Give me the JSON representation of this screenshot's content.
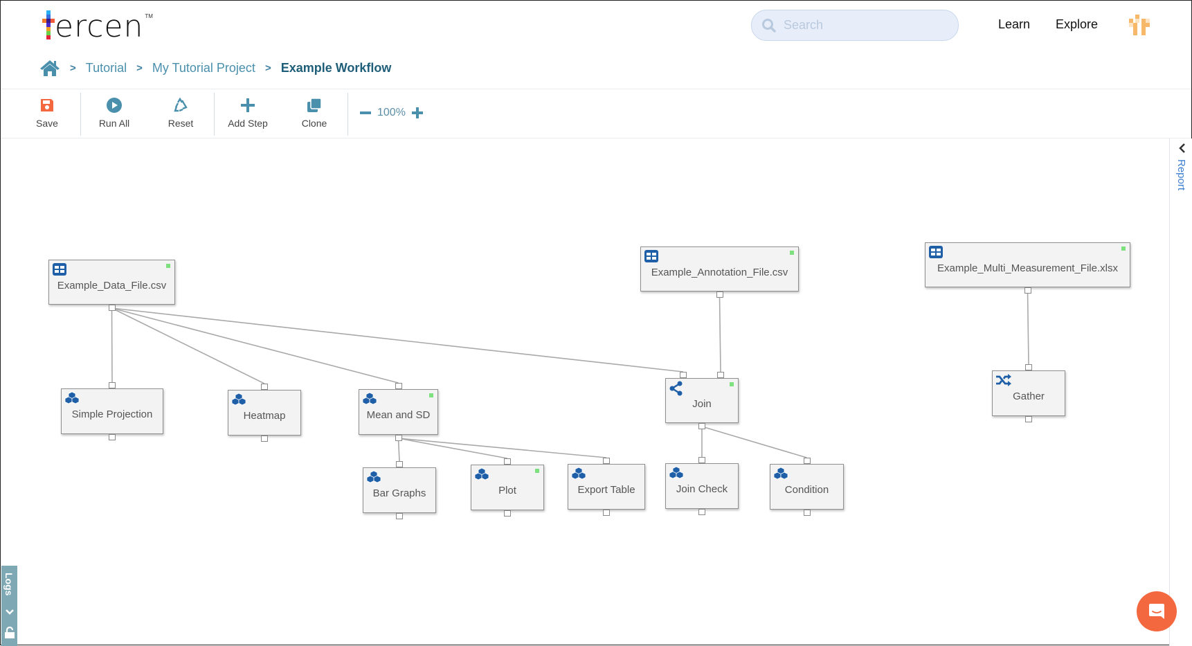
{
  "app": {
    "logo_text": "ercen",
    "logo_tm": "TM",
    "search_placeholder": "Search",
    "nav": {
      "learn": "Learn",
      "explore": "Explore"
    }
  },
  "breadcrumb": {
    "items": [
      "Tutorial",
      "My Tutorial Project"
    ],
    "current": "Example Workflow",
    "separator": ">"
  },
  "toolbar": {
    "save": "Save",
    "run_all": "Run All",
    "reset": "Reset",
    "add_step": "Add Step",
    "clone": "Clone",
    "zoom_level": "100%"
  },
  "workflow": {
    "nodes": [
      {
        "id": "data_file",
        "label": "Example_Data_File.csv",
        "type": "table",
        "status": "done"
      },
      {
        "id": "annotation_file",
        "label": "Example_Annotation_File.csv",
        "type": "table",
        "status": "done"
      },
      {
        "id": "multi_file",
        "label": "Example_Multi_Measurement_File.xlsx",
        "type": "table",
        "status": "done"
      },
      {
        "id": "simple_projection",
        "label": "Simple Projection",
        "type": "data-step",
        "status": ""
      },
      {
        "id": "heatmap",
        "label": "Heatmap",
        "type": "data-step",
        "status": ""
      },
      {
        "id": "mean_sd",
        "label": "Mean and SD",
        "type": "data-step",
        "status": "done"
      },
      {
        "id": "join",
        "label": "Join",
        "type": "join",
        "status": "done"
      },
      {
        "id": "gather",
        "label": "Gather",
        "type": "gather",
        "status": ""
      },
      {
        "id": "bar_graphs",
        "label": "Bar Graphs",
        "type": "data-step",
        "status": ""
      },
      {
        "id": "plot",
        "label": "Plot",
        "type": "data-step",
        "status": "done"
      },
      {
        "id": "export_table",
        "label": "Export Table",
        "type": "data-step",
        "status": ""
      },
      {
        "id": "join_check",
        "label": "Join Check",
        "type": "data-step",
        "status": ""
      },
      {
        "id": "condition",
        "label": "Condition",
        "type": "data-step",
        "status": ""
      }
    ],
    "links": [
      [
        "data_file",
        "simple_projection"
      ],
      [
        "data_file",
        "heatmap"
      ],
      [
        "data_file",
        "mean_sd"
      ],
      [
        "data_file",
        "join"
      ],
      [
        "annotation_file",
        "join"
      ],
      [
        "multi_file",
        "gather"
      ],
      [
        "mean_sd",
        "bar_graphs"
      ],
      [
        "mean_sd",
        "plot"
      ],
      [
        "mean_sd",
        "export_table"
      ],
      [
        "join",
        "join_check"
      ],
      [
        "join",
        "condition"
      ]
    ]
  },
  "side_panels": {
    "report": "Report",
    "logs": "Logs"
  },
  "colors": {
    "accent": "#4a90ad",
    "save": "#f4683f",
    "icon_blue": "#1e5fa8",
    "status_ok": "#7ee07e",
    "chat": "#f4683f"
  }
}
